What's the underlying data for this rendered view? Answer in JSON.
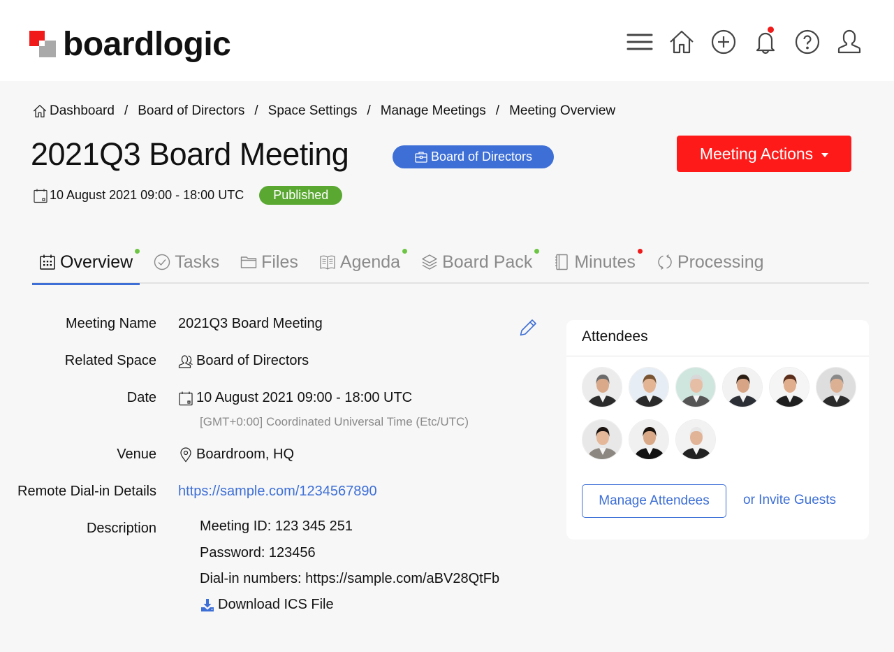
{
  "app": {
    "name": "boardlogic"
  },
  "header": {
    "icons": [
      {
        "name": "menu-icon"
      },
      {
        "name": "home-icon"
      },
      {
        "name": "add-icon"
      },
      {
        "name": "bell-icon",
        "has_notification": true
      },
      {
        "name": "help-icon"
      },
      {
        "name": "user-icon"
      }
    ]
  },
  "breadcrumb": [
    "Dashboard",
    "Board of Directors",
    "Space Settings",
    "Manage Meetings",
    "Meeting Overview"
  ],
  "breadcrumb_separator": "/",
  "meeting": {
    "title": "2021Q3 Board Meeting",
    "space_badge": "Board of Directors",
    "actions_label": "Meeting Actions",
    "date_line": "10 August 2021 09:00 - 18:00 UTC",
    "status": "Published"
  },
  "colors": {
    "accent": "#3d6fd6",
    "danger": "#ff1a1a",
    "success": "#5aa832",
    "dot_green": "#6cc644",
    "dot_red": "#f01a1a"
  },
  "tabs": [
    {
      "label": "Overview",
      "icon": "calendar-icon",
      "active": true,
      "dot": "green"
    },
    {
      "label": "Tasks",
      "icon": "check-circle-icon",
      "active": false,
      "dot": null
    },
    {
      "label": "Files",
      "icon": "folder-icon",
      "active": false,
      "dot": null
    },
    {
      "label": "Agenda",
      "icon": "book-icon",
      "active": false,
      "dot": "green"
    },
    {
      "label": "Board Pack",
      "icon": "layers-icon",
      "active": false,
      "dot": "green"
    },
    {
      "label": "Minutes",
      "icon": "notebook-icon",
      "active": false,
      "dot": "red"
    },
    {
      "label": "Processing",
      "icon": "refresh-icon",
      "active": false,
      "dot": null
    }
  ],
  "details": {
    "meeting_name": {
      "label": "Meeting Name",
      "value": "2021Q3 Board Meeting"
    },
    "related_space": {
      "label": "Related Space",
      "value": "Board of Directors"
    },
    "date": {
      "label": "Date",
      "value": "10 August 2021 09:00 - 18:00 UTC",
      "timezone": "[GMT+0:00] Coordinated Universal Time (Etc/UTC)"
    },
    "venue": {
      "label": "Venue",
      "value": "Boardroom, HQ"
    },
    "remote": {
      "label": "Remote Dial-in Details",
      "value": "https://sample.com/1234567890"
    },
    "description": {
      "label": "Description",
      "lines": [
        "Meeting ID: 123 345 251",
        "Password: 123456",
        "Dial-in numbers: https://sample.com/aBV28QtFb"
      ],
      "download_label": "Download ICS File"
    }
  },
  "attendees": {
    "title": "Attendees",
    "count": 9,
    "manage_label": "Manage Attendees",
    "invite_label": "or Invite Guests"
  }
}
